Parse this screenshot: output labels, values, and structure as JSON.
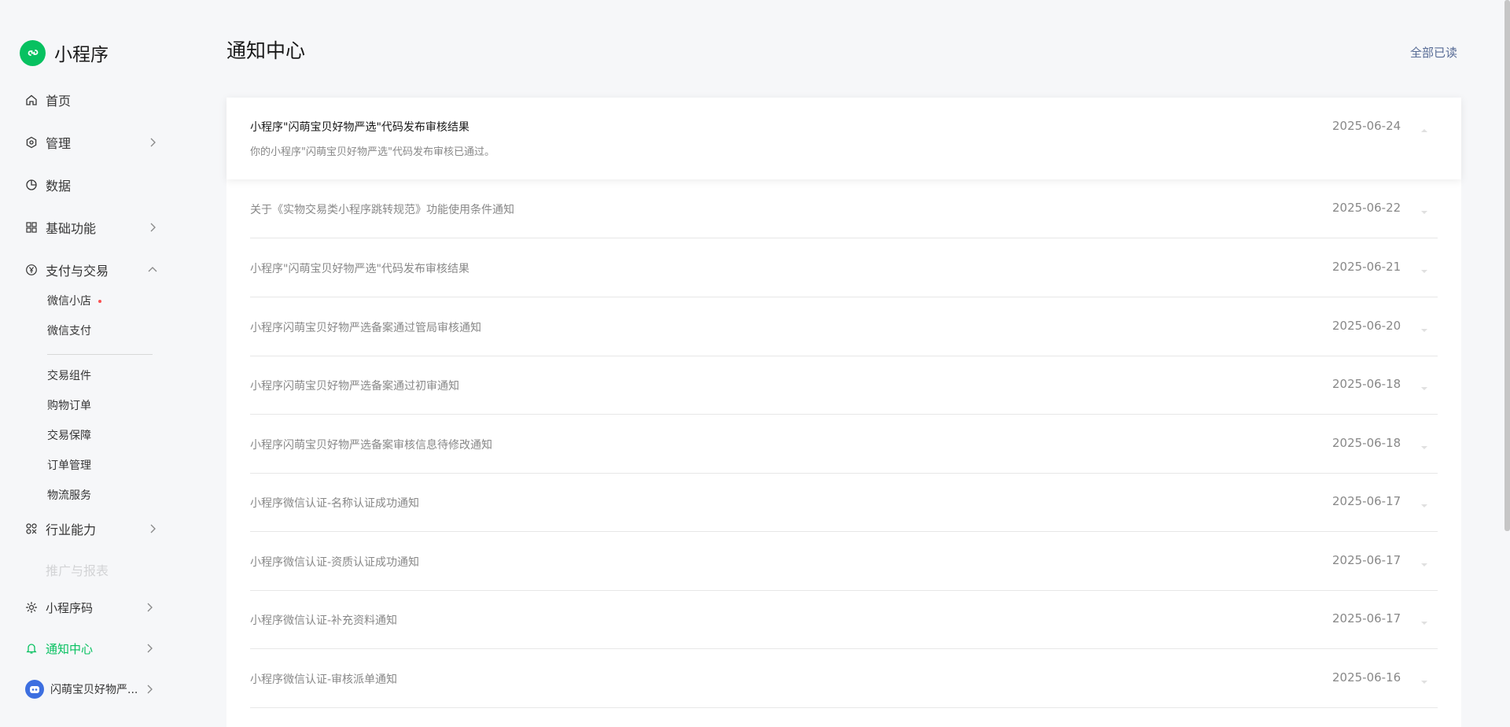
{
  "app": {
    "title": "小程序"
  },
  "sidebar": {
    "home": "首页",
    "manage": "管理",
    "data": "数据",
    "basic": "基础功能",
    "payment": "支付与交易",
    "payment_sub": [
      "微信小店",
      "微信支付",
      "交易组件",
      "购物订单",
      "交易保障",
      "订单管理",
      "物流服务"
    ],
    "industry": "行业能力",
    "faded": "推广与报表",
    "qrcode": "小程序码",
    "notify": "通知中心",
    "account": "闪萌宝贝好物严..."
  },
  "header": {
    "title": "通知中心",
    "read_all": "全部已读"
  },
  "notifications": {
    "expanded": {
      "title": "小程序\"闪萌宝贝好物严选\"代码发布审核结果",
      "body": "你的小程序\"闪萌宝贝好物严选\"代码发布审核已通过。",
      "date": "2025-06-24"
    },
    "items": [
      {
        "title": "关于《实物交易类小程序跳转规范》功能使用条件通知",
        "date": "2025-06-22"
      },
      {
        "title": "小程序\"闪萌宝贝好物严选\"代码发布审核结果",
        "date": "2025-06-21"
      },
      {
        "title": "小程序闪萌宝贝好物严选备案通过管局审核通知",
        "date": "2025-06-20"
      },
      {
        "title": "小程序闪萌宝贝好物严选备案通过初审通知",
        "date": "2025-06-18"
      },
      {
        "title": "小程序闪萌宝贝好物严选备案审核信息待修改通知",
        "date": "2025-06-18"
      },
      {
        "title": "小程序微信认证-名称认证成功通知",
        "date": "2025-06-17"
      },
      {
        "title": "小程序微信认证-资质认证成功通知",
        "date": "2025-06-17"
      },
      {
        "title": "小程序微信认证-补充资料通知",
        "date": "2025-06-17"
      },
      {
        "title": "小程序微信认证-审核派单通知",
        "date": "2025-06-16"
      }
    ]
  },
  "colors": {
    "brand": "#07c160",
    "link": "#576b95",
    "badge": "#fa5151"
  }
}
